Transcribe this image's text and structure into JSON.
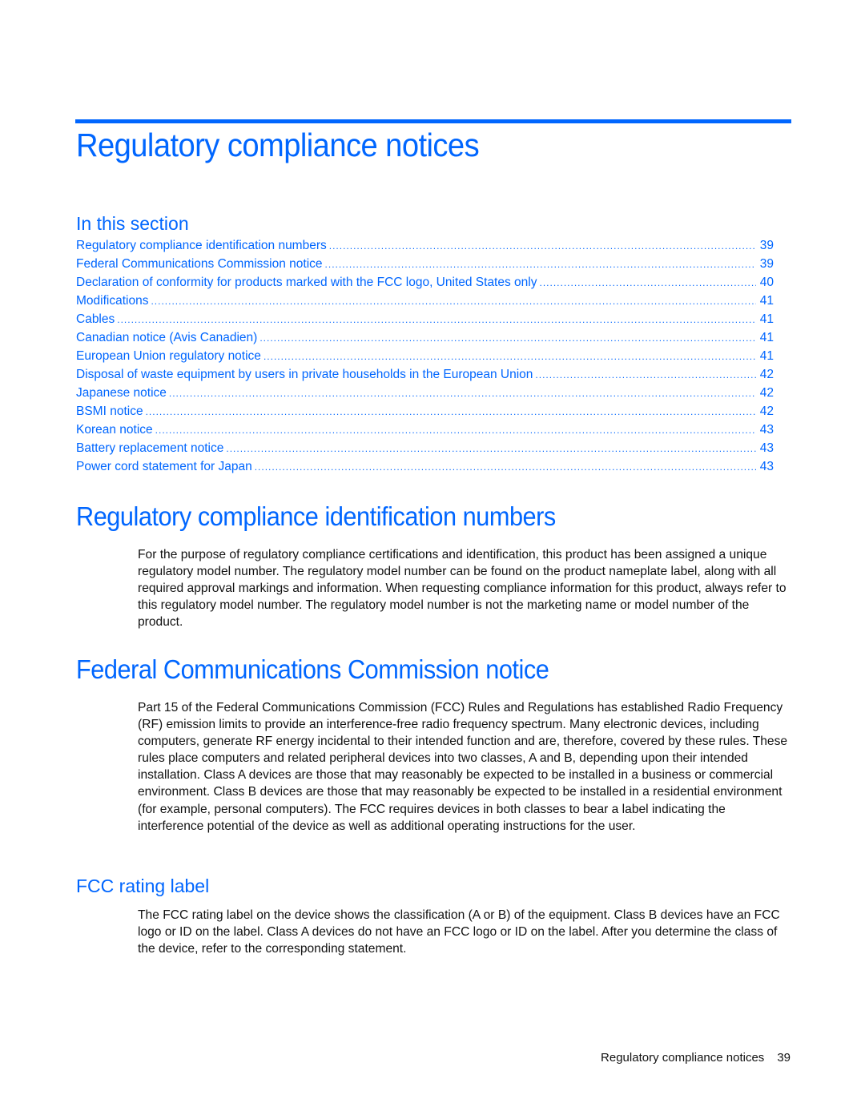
{
  "chapter": {
    "title": "Regulatory compliance notices"
  },
  "in_this_section": {
    "label": "In this section",
    "items": [
      {
        "title": "Regulatory compliance identification numbers",
        "page": "39"
      },
      {
        "title": "Federal Communications Commission notice",
        "page": "39"
      },
      {
        "title": "Declaration of conformity for products marked with the FCC logo, United States only",
        "page": "40"
      },
      {
        "title": "Modifications",
        "page": "41"
      },
      {
        "title": "Cables",
        "page": "41"
      },
      {
        "title": "Canadian notice (Avis Canadien)",
        "page": "41"
      },
      {
        "title": "European Union regulatory notice",
        "page": "41"
      },
      {
        "title": "Disposal of waste equipment by users in private households in the European Union",
        "page": "42"
      },
      {
        "title": "Japanese notice",
        "page": "42"
      },
      {
        "title": "BSMI notice",
        "page": "42"
      },
      {
        "title": "Korean notice",
        "page": "43"
      },
      {
        "title": "Battery replacement notice",
        "page": "43"
      },
      {
        "title": "Power cord statement for Japan",
        "page": "43"
      }
    ]
  },
  "sections": {
    "identification": {
      "heading": "Regulatory compliance identification numbers",
      "body": "For the purpose of regulatory compliance certifications and identification, this product has been assigned a unique regulatory model number. The regulatory model number can be found on the product nameplate label, along with all required approval markings and information. When requesting compliance information for this product, always refer to this regulatory model number. The regulatory model number is not the marketing name or model number of the product."
    },
    "fcc": {
      "heading": "Federal Communications Commission notice",
      "body": "Part 15 of the Federal Communications Commission (FCC) Rules and Regulations has established Radio Frequency (RF) emission limits to provide an interference-free radio frequency spectrum. Many electronic devices, including computers, generate RF energy incidental to their intended function and are, therefore, covered by these rules. These rules place computers and related peripheral devices into two classes, A and B, depending upon their intended installation. Class A devices are those that may reasonably be expected to be installed in a business or commercial environment. Class B devices are those that may reasonably be expected to be installed in a residential environment (for example, personal computers). The FCC requires devices in both classes to bear a label indicating the interference potential of the device as well as additional operating instructions for the user."
    },
    "fcc_rating": {
      "heading": "FCC rating label",
      "body": "The FCC rating label on the device shows the classification (A or B) of the equipment. Class B devices have an FCC logo or ID on the label. Class A devices do not have an FCC logo or ID on the label. After you determine the class of the device, refer to the corresponding statement."
    }
  },
  "footer": {
    "chapter": "Regulatory compliance notices",
    "page": "39"
  },
  "colors": {
    "accent": "#0066ff",
    "text": "#111111"
  }
}
